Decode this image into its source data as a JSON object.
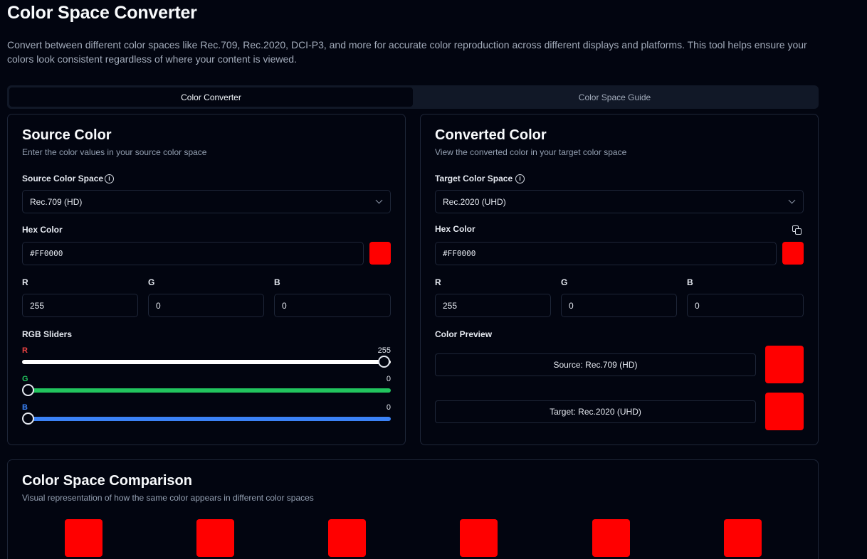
{
  "page": {
    "title": "Color Space Converter",
    "description": "Convert between different color spaces like Rec.709, Rec.2020, DCI-P3, and more for accurate color reproduction across different displays and platforms. This tool helps ensure your colors look consistent regardless of where your content is viewed."
  },
  "tabs": [
    {
      "label": "Color Converter",
      "active": true
    },
    {
      "label": "Color Space Guide",
      "active": false
    }
  ],
  "source": {
    "title": "Source Color",
    "subtitle": "Enter the color values in your source color space",
    "space_label": "Source Color Space",
    "space_value": "Rec.709 (HD)",
    "hex_label": "Hex Color",
    "hex_value": "#FF0000",
    "r_label": "R",
    "g_label": "G",
    "b_label": "B",
    "r_value": "255",
    "g_value": "0",
    "b_value": "0",
    "sliders_label": "RGB Sliders",
    "slider_r": {
      "letter": "R",
      "value": "255",
      "fraction": 1.0,
      "color": "#ef4444"
    },
    "slider_g": {
      "letter": "G",
      "value": "0",
      "fraction": 0.0,
      "color": "#22c55e"
    },
    "slider_b": {
      "letter": "B",
      "value": "0",
      "fraction": 0.0,
      "color": "#3b82f6"
    }
  },
  "converted": {
    "title": "Converted Color",
    "subtitle": "View the converted color in your target color space",
    "space_label": "Target Color Space",
    "space_value": "Rec.2020 (UHD)",
    "hex_label": "Hex Color",
    "hex_value": "#FF0000",
    "r_label": "R",
    "g_label": "G",
    "b_label": "B",
    "r_value": "255",
    "g_value": "0",
    "b_value": "0",
    "preview_label": "Color Preview",
    "preview_source": "Source: Rec.709 (HD)",
    "preview_target": "Target: Rec.2020 (UHD)"
  },
  "comparison": {
    "title": "Color Space Comparison",
    "subtitle": "Visual representation of how the same color appears in different color spaces"
  },
  "colors": {
    "swatch": "#ff0000",
    "accent_bg": "#020510",
    "border": "#1e2638"
  },
  "icons": {
    "info": "info-circle-icon",
    "chevron": "chevron-down-icon",
    "copy": "copy-icon"
  }
}
